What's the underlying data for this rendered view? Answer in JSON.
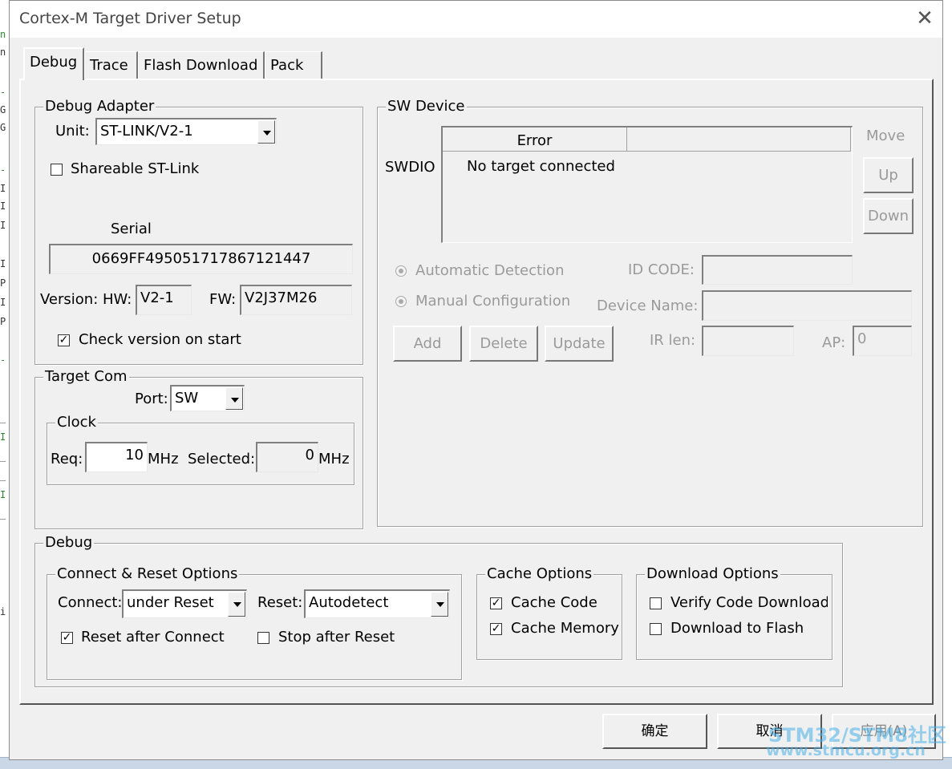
{
  "window": {
    "title": "Cortex-M Target Driver Setup",
    "close_glyph": "✕"
  },
  "tabs": [
    {
      "label": "Debug",
      "active": true
    },
    {
      "label": "Trace",
      "active": false
    },
    {
      "label": "Flash Download",
      "active": false
    },
    {
      "label": "Pack",
      "active": false
    }
  ],
  "debug_adapter": {
    "legend": "Debug Adapter",
    "unit_label": "Unit:",
    "unit_value": "ST-LINK/V2-1",
    "shareable_label": "Shareable ST-Link",
    "shareable_checked": false,
    "serial_label": "Serial",
    "serial_value": "0669FF495051717867121447",
    "version_label": "Version: HW:",
    "hw_value": "V2-1",
    "fw_label": "FW:",
    "fw_value": "V2J37M26",
    "check_version_label": "Check version on start",
    "check_version_checked": true
  },
  "target_com": {
    "legend": "Target Com",
    "port_label": "Port:",
    "port_value": "SW",
    "clock_legend": "Clock",
    "req_label": "Req:",
    "req_value": "10",
    "req_unit": "MHz",
    "selected_label": "Selected:",
    "selected_value": "0",
    "selected_unit": "MHz"
  },
  "sw_device": {
    "legend": "SW Device",
    "row_label": "SWDIO",
    "col_error": "Error",
    "row_error": "No target connected",
    "move_label": "Move",
    "up_button": "Up",
    "down_button": "Down",
    "auto_detect_label": "Automatic Detection",
    "manual_config_label": "Manual Configuration",
    "id_code_label": "ID CODE:",
    "id_code_value": "",
    "device_name_label": "Device Name:",
    "device_name_value": "",
    "add_button": "Add",
    "delete_button": "Delete",
    "update_button": "Update",
    "ir_len_label": "IR len:",
    "ir_len_value": "",
    "ap_label": "AP:",
    "ap_value": "0"
  },
  "debug": {
    "legend": "Debug",
    "connect_reset": {
      "legend": "Connect & Reset Options",
      "connect_label": "Connect:",
      "connect_value": "under Reset",
      "reset_label": "Reset:",
      "reset_value": "Autodetect",
      "reset_after_connect_label": "Reset after Connect",
      "reset_after_connect_checked": true,
      "stop_after_reset_label": "Stop after Reset",
      "stop_after_reset_checked": false
    },
    "cache": {
      "legend": "Cache Options",
      "cache_code_label": "Cache Code",
      "cache_code_checked": true,
      "cache_memory_label": "Cache Memory",
      "cache_memory_checked": true
    },
    "download": {
      "legend": "Download Options",
      "verify_label": "Verify Code Download",
      "verify_checked": false,
      "download_flash_label": "Download to Flash",
      "download_flash_checked": false
    }
  },
  "footer": {
    "ok_button": "确定",
    "cancel_button": "取消",
    "apply_button": "应用(A)"
  },
  "watermark": {
    "line1": "STM32/STM8社区",
    "line2": "www.stmcu.org.cn"
  },
  "colors": {
    "dialog_bg": "#f0f0f0",
    "disabled_text": "#9a9a9a",
    "watermark": "#4ab0e8"
  },
  "check_glyph": "✓"
}
